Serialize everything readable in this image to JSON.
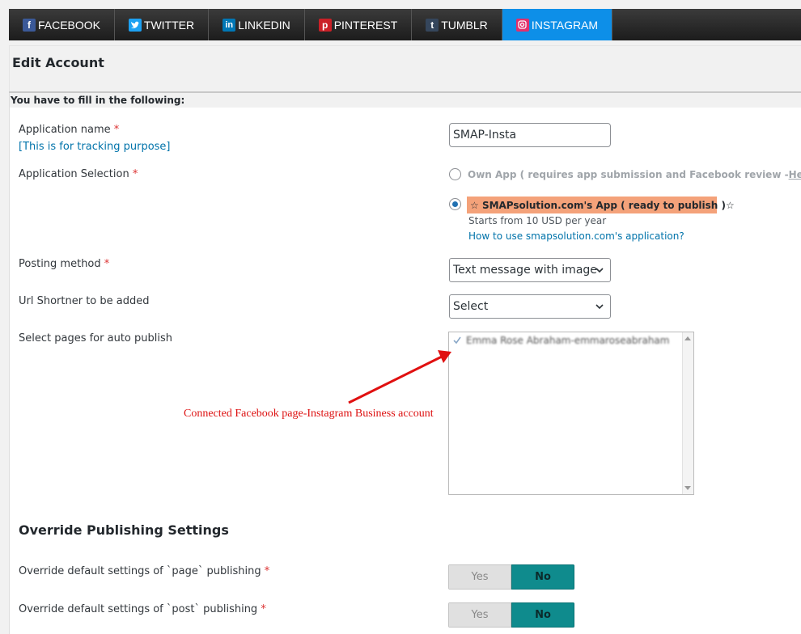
{
  "tabs": [
    {
      "label": "FACEBOOK",
      "icon": "facebook-icon",
      "color": "#3b5998",
      "active": false
    },
    {
      "label": "TWITTER",
      "icon": "twitter-icon",
      "color": "#1da1f2",
      "active": false
    },
    {
      "label": "LINKEDIN",
      "icon": "linkedin-icon",
      "color": "#0077b5",
      "active": false
    },
    {
      "label": "PINTEREST",
      "icon": "pinterest-icon",
      "color": "#cb2027",
      "active": false
    },
    {
      "label": "TUMBLR",
      "icon": "tumblr-icon",
      "color": "#35465c",
      "active": false
    },
    {
      "label": "INSTAGRAM",
      "icon": "instagram-icon",
      "color": "#e1306c",
      "active": true
    }
  ],
  "page_title": "Edit Account",
  "section_note": "You have to fill in the following:",
  "form": {
    "app_name_label": "Application name",
    "app_name_hint": "[This is for tracking purpose]",
    "app_name_value": "SMAP-Insta",
    "app_selection_label": "Application Selection",
    "own_app_text": "Own App ( requires app submission and Facebook review -",
    "own_app_help": "Help",
    "own_app_close": ")",
    "smap_app_text": "SMAPsolution.com's App ( ready to publish )",
    "smap_price": "Starts from 10 USD per year",
    "smap_howto": "How to use smapsolution.com's application?",
    "posting_method_label": "Posting method",
    "posting_method_value": "Text message with image",
    "url_shortner_label": "Url Shortner to be added",
    "url_shortner_value": "Select",
    "pages_label": "Select pages for auto publish",
    "pages": [
      "Emma Rose Abraham-emmaroseabraham"
    ],
    "annotation": "Connected Facebook page-Instagram Business account",
    "required_mark": "*"
  },
  "override": {
    "heading": "Override Publishing Settings",
    "page_label": "Override default settings of `page` publishing",
    "post_label": "Override default settings of `post` publishing",
    "yes": "Yes",
    "no": "No"
  },
  "colors": {
    "tab_active": "#0d8fe8",
    "highlight": "#f4a27a",
    "toggle_on": "#0f8b8d",
    "annotation": "#dd1111",
    "link": "#0073aa"
  }
}
